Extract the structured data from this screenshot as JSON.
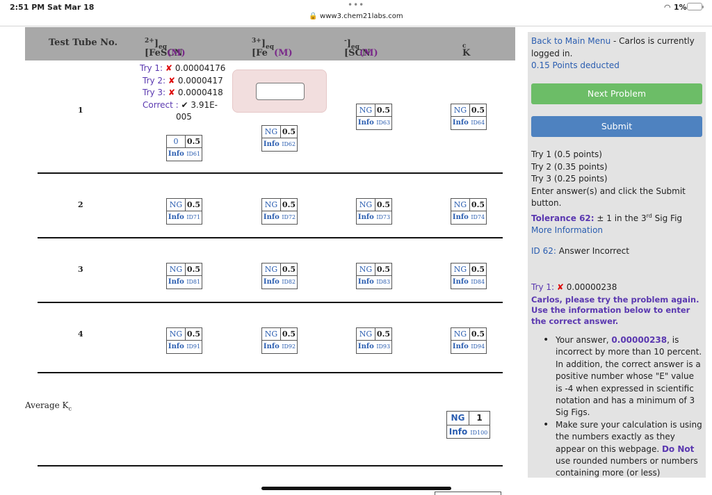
{
  "status_bar": {
    "time": "2:51 PM  Sat Mar 18",
    "url": "www3.chem21labs.com",
    "battery": "1%"
  },
  "table": {
    "headers": {
      "tube": "Test Tube No.",
      "fescn_base": "[FeSCN",
      "fescn_sup": "2+",
      "fescn_sub": "eq",
      "fescn_unit": "(M)",
      "fe_base": "[Fe",
      "fe_sup": "3+",
      "fe_sub": "eq",
      "fe_unit": "(M)",
      "scn_base": "[SCN",
      "scn_sup": "-",
      "scn_sub": "eq",
      "scn_unit": "(M)",
      "kc_base": "K",
      "kc_sub": "c"
    },
    "rows": [
      {
        "num": "1",
        "boxes": [
          {
            "a": "0",
            "b": "0.5",
            "info": "Info",
            "id": "ID61"
          },
          {
            "a": "NG",
            "b": "0.5",
            "info": "Info",
            "id": "ID62"
          },
          {
            "a": "NG",
            "b": "0.5",
            "info": "Info",
            "id": "ID63"
          },
          {
            "a": "NG",
            "b": "0.5",
            "info": "Info",
            "id": "ID64"
          }
        ]
      },
      {
        "num": "2",
        "boxes": [
          {
            "a": "NG",
            "b": "0.5",
            "info": "Info",
            "id": "ID71"
          },
          {
            "a": "NG",
            "b": "0.5",
            "info": "Info",
            "id": "ID72"
          },
          {
            "a": "NG",
            "b": "0.5",
            "info": "Info",
            "id": "ID73"
          },
          {
            "a": "NG",
            "b": "0.5",
            "info": "Info",
            "id": "ID74"
          }
        ]
      },
      {
        "num": "3",
        "boxes": [
          {
            "a": "NG",
            "b": "0.5",
            "info": "Info",
            "id": "ID81"
          },
          {
            "a": "NG",
            "b": "0.5",
            "info": "Info",
            "id": "ID82"
          },
          {
            "a": "NG",
            "b": "0.5",
            "info": "Info",
            "id": "ID83"
          },
          {
            "a": "NG",
            "b": "0.5",
            "info": "Info",
            "id": "ID84"
          }
        ]
      },
      {
        "num": "4",
        "boxes": [
          {
            "a": "NG",
            "b": "0.5",
            "info": "Info",
            "id": "ID91"
          },
          {
            "a": "NG",
            "b": "0.5",
            "info": "Info",
            "id": "ID92"
          },
          {
            "a": "NG",
            "b": "0.5",
            "info": "Info",
            "id": "ID93"
          },
          {
            "a": "NG",
            "b": "0.5",
            "info": "Info",
            "id": "ID94"
          }
        ]
      }
    ],
    "attempts": {
      "try1_label": "Try 1:",
      "try1_value": "0.00004176",
      "try2_label": "Try 2:",
      "try2_value": "0.0000417",
      "try3_label": "Try 3:",
      "try3_value": "0.0000418",
      "correct_label": "Correct :",
      "correct_value_1": "3.91E-",
      "correct_value_2": "005",
      "x_mark": "✘",
      "check_mark": "✔"
    },
    "average": {
      "label": "Average K",
      "sub": "c",
      "a": "NG",
      "b": "1",
      "info": "Info",
      "id": "ID100"
    }
  },
  "panel": {
    "back_link": "Back to Main Menu",
    "logged_in": " - Carlos is currently logged in.",
    "points_deducted": "0.15 Points deducted",
    "next_button": "Next Problem",
    "submit_button": "Submit",
    "try1_points": "Try 1 (0.5 points)",
    "try2_points": "Try 2 (0.35 points)",
    "try3_points": "Try 3 (0.25 points)",
    "instructions": "Enter answer(s) and click the Submit button.",
    "tolerance_label": "Tolerance 62:",
    "tolerance_text_pre": " ± 1 in the 3",
    "tolerance_sup": "rd",
    "tolerance_text_post": " Sig Fig",
    "more_info": "More Information",
    "id_label": "ID 62:",
    "id_status": " Answer Incorrect",
    "try1_label": "Try 1:",
    "try1_value": " 0.00000238",
    "retry_msg": "Carlos, please try the problem again. Use the information below to enter the correct answer.",
    "bullet1_pre": "Your answer, ",
    "bullet1_answer": "0.00000238",
    "bullet1_post": ", is incorrect by more than 10 percent. In addition, the correct answer is a positive number whose \"E\" value is -4 when expressed in scientific notation and has a minimum of 3 Sig Figs.",
    "bullet2_pre": "Make sure your calculation is using the numbers exactly as they appear on this webpage. ",
    "bullet2_bold": "Do Not",
    "bullet2_post": " use rounded numbers or numbers containing more (or less)"
  }
}
